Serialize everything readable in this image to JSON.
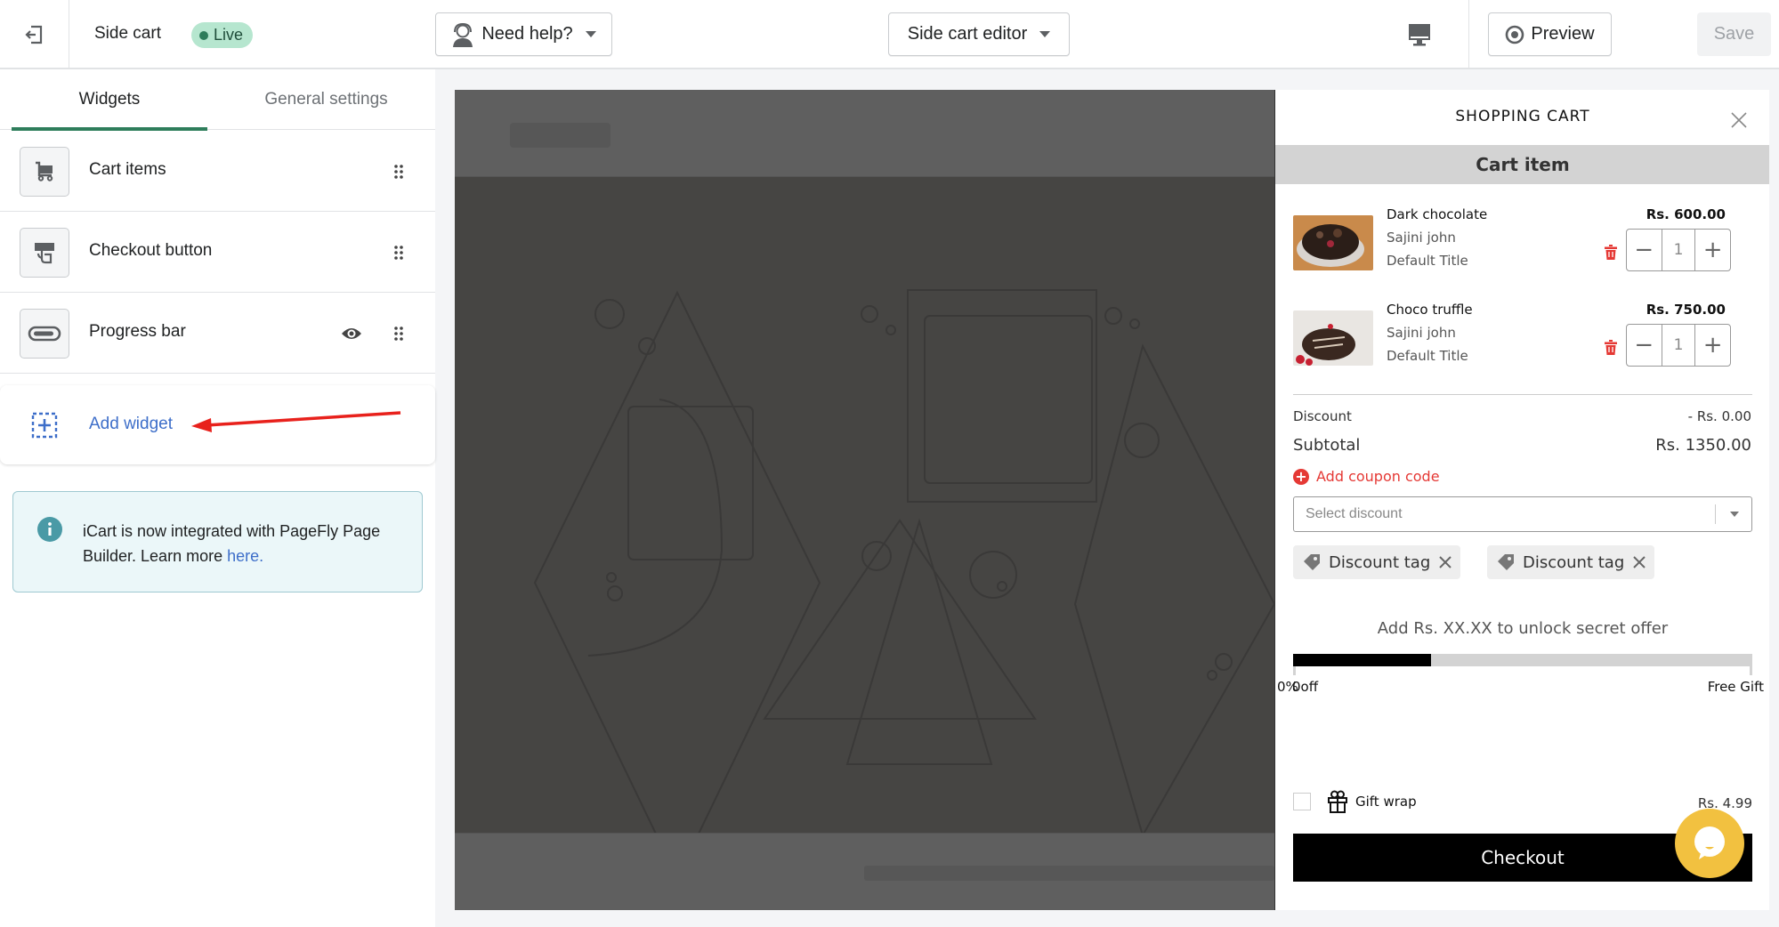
{
  "header": {
    "exit_icon": "exit-icon",
    "app_title": "Side cart",
    "status_badge": "Live",
    "help_button": "Need help?",
    "editor_select": "Side cart editor",
    "device_icon": "desktop-icon",
    "preview_button": "Preview",
    "save_button": "Save"
  },
  "sidebar": {
    "tabs": [
      {
        "label": "Widgets",
        "active": true
      },
      {
        "label": "General settings",
        "active": false
      }
    ],
    "widgets": [
      {
        "label": "Cart items",
        "icon": "cart-icon",
        "visibility_toggle": false
      },
      {
        "label": "Checkout button",
        "icon": "checkout-tap-icon",
        "visibility_toggle": false
      },
      {
        "label": "Progress bar",
        "icon": "progress-bar-icon",
        "visibility_toggle": true
      }
    ],
    "add_widget": "Add widget",
    "info": {
      "text": "iCart is now integrated with PageFly Page Builder. Learn more ",
      "link": "here."
    }
  },
  "cart": {
    "title": "SHOPPING CART",
    "section_title": "Cart item",
    "items": [
      {
        "name": "Dark chocolate",
        "vendor": "Sajini john",
        "variant": "Default Title",
        "price": "Rs. 600.00",
        "quantity": "1"
      },
      {
        "name": "Choco truffle",
        "vendor": "Sajini john",
        "variant": "Default Title",
        "price": "Rs. 750.00",
        "quantity": "1"
      }
    ],
    "discount_label": "Discount",
    "discount_value": "- Rs. 0.00",
    "subtotal_label": "Subtotal",
    "subtotal_value": "Rs. 1350.00",
    "coupon_link": "Add coupon code",
    "select_discount_placeholder": "Select discount",
    "tags": [
      "Discount tag",
      "Discount tag"
    ],
    "offer_text": "Add Rs. XX.XX to unlock secret offer",
    "progress": {
      "percent": 30,
      "start_label_a": "0%",
      "start_label_b": "0off",
      "end_label": "Free Gift"
    },
    "gift_wrap": {
      "label": "Gift wrap",
      "price": "Rs. 4.99",
      "checked": false
    },
    "checkout_button": "Checkout"
  },
  "colors": {
    "accent_green": "#2e7d5b",
    "link_blue": "#3d6ec9",
    "coupon_red": "#e53935",
    "chat_yellow": "#f2c140"
  }
}
